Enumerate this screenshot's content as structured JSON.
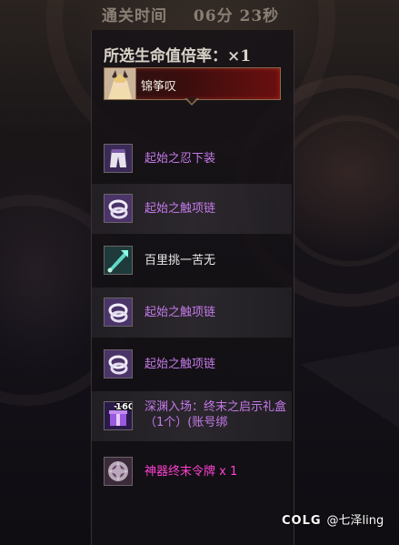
{
  "header": {
    "time_label": "通关时间",
    "time_value": "06分 23秒"
  },
  "result": {
    "hp_rate_line": "所选生命值倍率：×1",
    "player_name": "锦筝叹"
  },
  "loot": [
    {
      "name": "起始之忍下装",
      "icon": "pants-icon",
      "color": "#c47ae8"
    },
    {
      "name": "起始之触项链",
      "icon": "necklace-icon",
      "color": "#c47ae8"
    },
    {
      "name": "百里挑一苦无",
      "icon": "kunai-icon",
      "color": "#e8e8e8"
    },
    {
      "name": "起始之触项链",
      "icon": "necklace-icon",
      "color": "#c47ae8"
    },
    {
      "name": "起始之触项链",
      "icon": "necklace-icon",
      "color": "#c47ae8"
    },
    {
      "name": "深渊入场：终末之启示礼盒（1个）(账号绑",
      "icon": "gift-box-icon",
      "color": "#c47ae8",
      "count": "160"
    },
    {
      "name": "神器终末令牌 x 1",
      "icon": "token-icon",
      "color": "#ff40d2"
    }
  ],
  "watermark": {
    "brand": "COLG",
    "handle": "@七泽ling"
  }
}
